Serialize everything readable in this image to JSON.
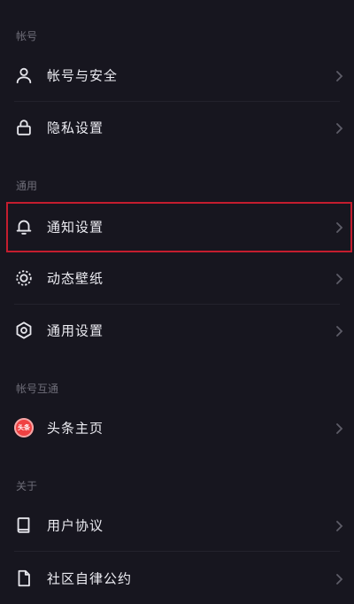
{
  "sections": {
    "account": "帐号",
    "general": "通用",
    "interop": "帐号互通",
    "about": "关于"
  },
  "items": {
    "account_security": {
      "label": "帐号与安全",
      "icon": "user-icon"
    },
    "privacy": {
      "label": "隐私设置",
      "icon": "lock-icon"
    },
    "notifications": {
      "label": "通知设置",
      "icon": "bell-icon"
    },
    "live_wallpaper": {
      "label": "动态壁纸",
      "icon": "wallpaper-icon"
    },
    "general_settings": {
      "label": "通用设置",
      "icon": "settings-gear-icon"
    },
    "toutiao_home": {
      "label": "头条主页",
      "icon": "toutiao-logo-icon",
      "badge_text": "头条"
    },
    "user_agreement": {
      "label": "用户协议",
      "icon": "book-icon"
    },
    "community_guidelines": {
      "label": "社区自律公约",
      "icon": "document-icon"
    }
  },
  "colors": {
    "background": "#17161f",
    "highlight_border": "#c41d2e",
    "section_text": "#6e6d78",
    "toutiao_red": "#f04142"
  }
}
